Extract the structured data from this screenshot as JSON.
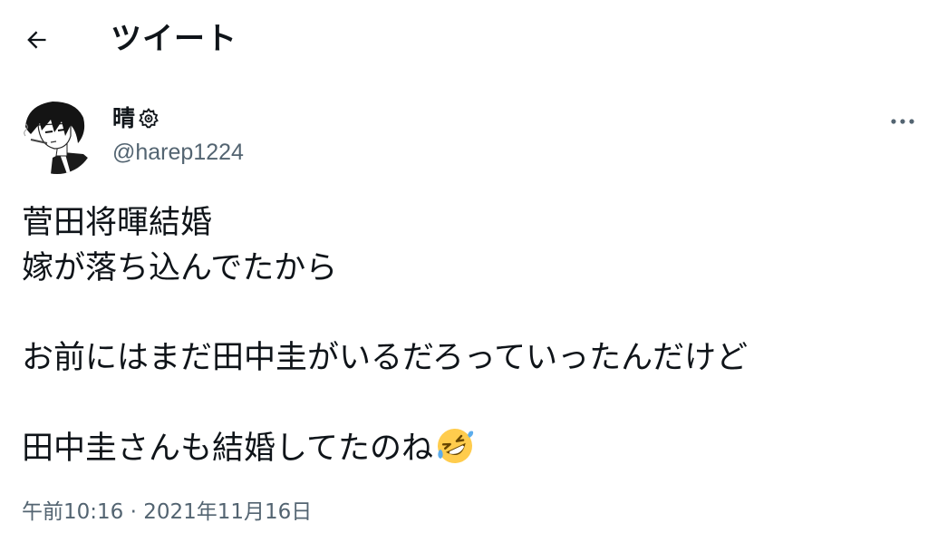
{
  "header": {
    "back_icon": "arrow-left-icon",
    "title": "ツイート"
  },
  "author": {
    "display_name": "晴",
    "badge_icon": "gear-badge-icon",
    "handle": "@harep1224",
    "avatar_icon": "anime-character-avatar"
  },
  "more_icon": "ellipsis-icon",
  "tweet": {
    "lines": [
      "菅田将暉結婚",
      "嫁が落ち込んでたから",
      "",
      "お前にはまだ田中圭がいるだろっていったんだけど",
      "",
      "田中圭さんも結婚してたのね"
    ],
    "trailing_emoji": "rolling-on-floor-laughing-emoji"
  },
  "timestamp": "午前10:16 · 2021年11月16日"
}
